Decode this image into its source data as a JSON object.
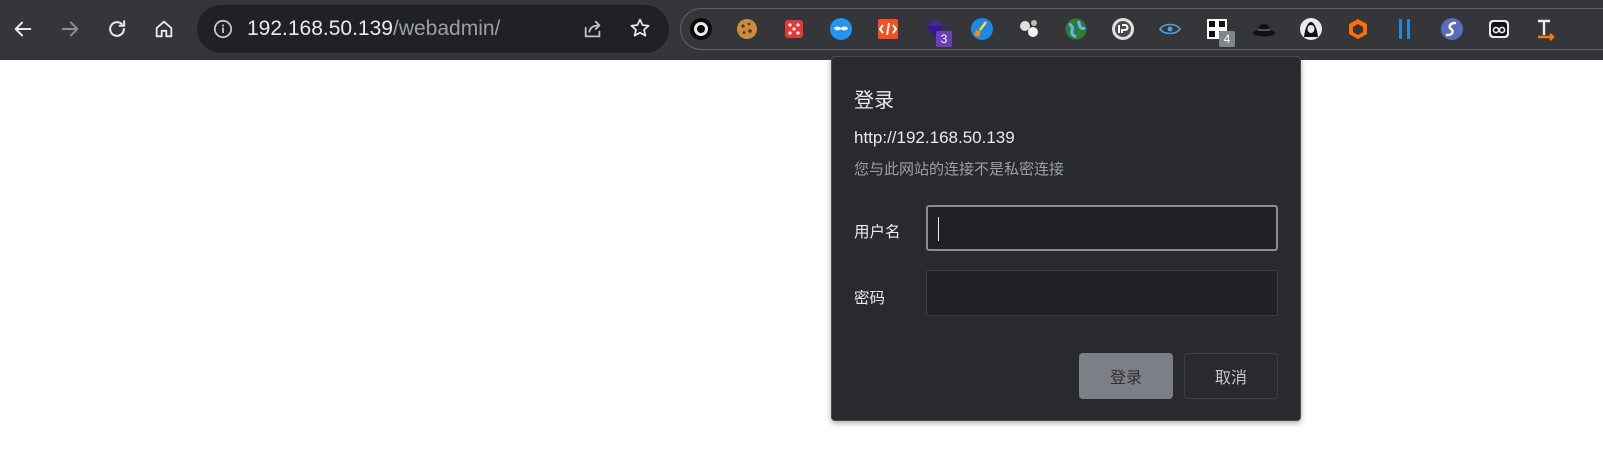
{
  "browser": {
    "address_bar": {
      "host": "192.168.50.139",
      "path": "/webadmin/"
    },
    "extension_badges": {
      "ext4": "3",
      "ext12": "4"
    },
    "colors": {
      "toolbar": "#35363a",
      "omnibox": "#202124",
      "badge_purple": "#6a3fb8",
      "badge_gray": "#80868b"
    }
  },
  "dialog": {
    "title": "登录",
    "origin": "http://192.168.50.139",
    "warning": "您与此网站的连接不是私密连接",
    "username_label": "用户名",
    "username_value": "",
    "password_label": "密码",
    "password_value": "",
    "login_button": "登录",
    "cancel_button": "取消"
  }
}
